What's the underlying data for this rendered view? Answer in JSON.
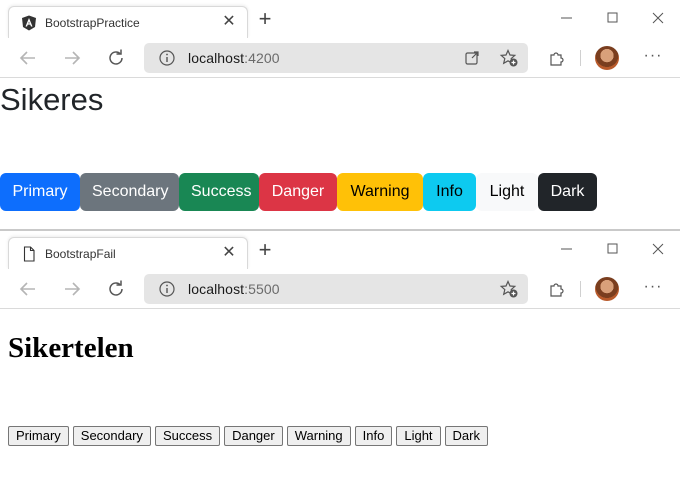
{
  "windows": [
    {
      "tab_title": "BootstrapPractice",
      "url_host": "localhost",
      "url_port": ":4200",
      "heading": "Sikeres",
      "buttons": [
        "Primary",
        "Secondary",
        "Success",
        "Danger",
        "Warning",
        "Info",
        "Light",
        "Dark"
      ]
    },
    {
      "tab_title": "BootstrapFail",
      "url_host": "localhost",
      "url_port": ":5500",
      "heading": "Sikertelen",
      "buttons": [
        "Primary",
        "Secondary",
        "Success",
        "Danger",
        "Warning",
        "Info",
        "Light",
        "Dark"
      ]
    }
  ],
  "colors": {
    "primary": "#0d6efd",
    "secondary": "#6c757d",
    "success": "#198754",
    "danger": "#dc3545",
    "warning": "#ffc107",
    "info": "#0dcaf0",
    "light": "#f8f9fa",
    "dark": "#212529"
  },
  "icons": {
    "tab1": "angular-logo-icon",
    "tab2": "document-icon"
  }
}
